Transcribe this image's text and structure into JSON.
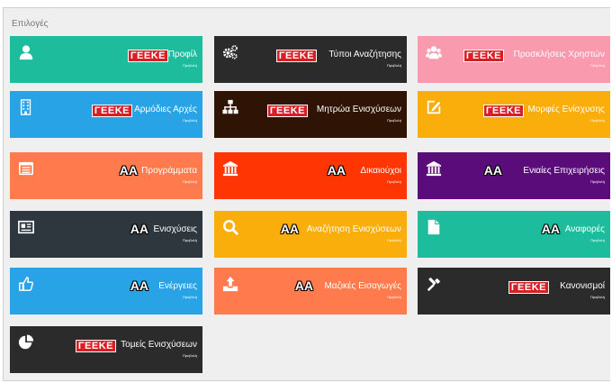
{
  "section_title": "Επιλογές",
  "tiles": [
    {
      "title": "Προφίλ",
      "subtitle": "Προβολή",
      "logo": "ΓΕΕΚΕ",
      "icon": "user-icon",
      "color": "#1cbc9c"
    },
    {
      "title": "Τύποι Αναζήτησης",
      "subtitle": "Προβολή",
      "logo": "ΓΕΕΚΕ",
      "icon": "gears-icon",
      "color": "#2b2b2b"
    },
    {
      "title": "Προσκλήσεις Χρηστών",
      "subtitle": "Προβολή",
      "logo": "ΓΕΕΚΕ",
      "icon": "users-icon",
      "color": "#f99aaf"
    },
    {
      "title": "Αρμόδιες Αρχές",
      "subtitle": "Προβολή",
      "logo": "ΓΕΕΚΕ",
      "icon": "building-icon",
      "color": "#27a3e6"
    },
    {
      "title": "Μητρώα Ενισχύσεων",
      "subtitle": "Προβολή",
      "logo": "ΓΕΕΚΕ",
      "icon": "sitemap-icon",
      "color": "#2f1304"
    },
    {
      "title": "Μορφές Ενίσχυσης",
      "subtitle": "Προβολή",
      "logo": "ΓΕΕΚΕ",
      "icon": "edit-icon",
      "color": "#f9ae0b"
    },
    {
      "title": "Προγράμματα",
      "subtitle": "Προβολή",
      "logo": "ΑΑ",
      "icon": "list-icon",
      "color": "#ff7a4c"
    },
    {
      "title": "Δικαιούχοι",
      "subtitle": "Προβολή",
      "logo": "ΑΑ",
      "icon": "bank-icon",
      "color": "#ff3503"
    },
    {
      "title": "Ενιαίες Επιχειρήσεις",
      "subtitle": "Προβολή",
      "logo": "ΑΑ",
      "icon": "bank-icon",
      "color": "#5b0c7b"
    },
    {
      "title": "Ενισχύσεις",
      "subtitle": "Προβολή",
      "logo": "ΑΑ",
      "icon": "newspaper-icon",
      "color": "#2f373e"
    },
    {
      "title": "Αναζήτηση Ενισχύσεων",
      "subtitle": "Προβολή",
      "logo": "ΑΑ",
      "icon": "search-icon",
      "color": "#f9ae0b"
    },
    {
      "title": "Αναφορές",
      "subtitle": "Προβολή",
      "logo": "ΑΑ",
      "icon": "file-icon",
      "color": "#1cbc9c"
    },
    {
      "title": "Ενέργειες",
      "subtitle": "Προβολή",
      "logo": "ΑΑ",
      "icon": "thumbs-up-icon",
      "color": "#27a3e6"
    },
    {
      "title": "Μαζικές Εισαγωγές",
      "subtitle": "Προβολή",
      "logo": "ΑΑ",
      "icon": "upload-icon",
      "color": "#ff7a4c"
    },
    {
      "title": "Κανονισμοί",
      "subtitle": "Προβολή",
      "logo": "ΓΕΕΚΕ",
      "icon": "gavel-icon",
      "color": "#2b2b2b"
    },
    {
      "title": "Τομείς Ενισχύσεων",
      "subtitle": "Προβολή",
      "logo": "ΓΕΕΚΕ",
      "icon": "pie-chart-icon",
      "color": "#2b2b2b"
    }
  ]
}
